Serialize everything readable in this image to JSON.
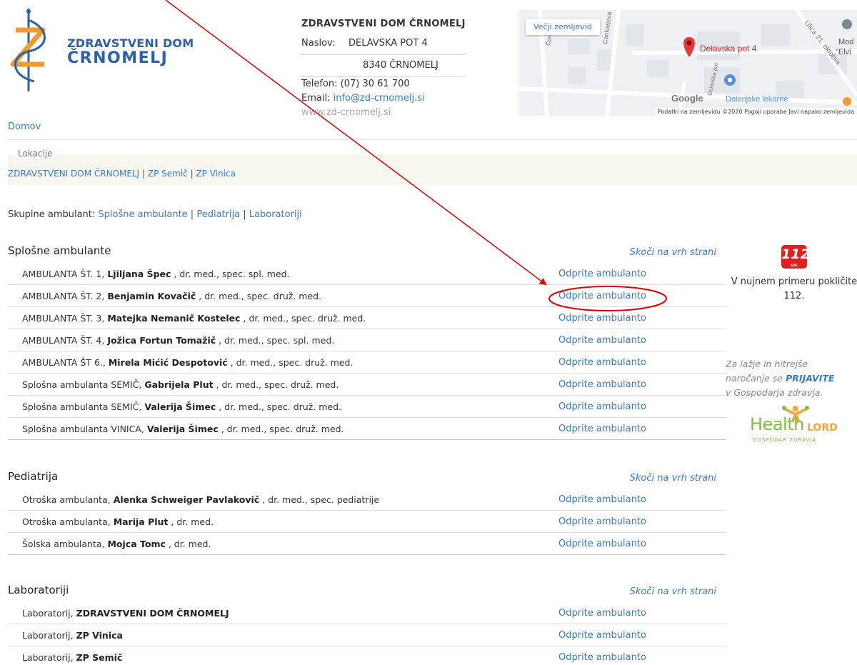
{
  "header": {
    "logo": {
      "line1": "ZDRAVSTVENI DOM",
      "line2": "ČRNOMELJ"
    },
    "title": "ZDRAVSTVENI DOM ČRNOMELJ",
    "address_label": "Naslov:",
    "address_line1": "DELAVSKA POT 4",
    "address_line2": "8340 ČRNOMELJ",
    "phone_label": "Telefon:",
    "phone": "(07) 30 61 700",
    "email_label": "Email:",
    "email": "info@zd-crnomelj.si",
    "web": "www.zd-crnomelj.si"
  },
  "map": {
    "button": "Večji zemljevid",
    "labels": {
      "street1": "Delavska pot 4",
      "street2": "Cankarjeva",
      "street3": "Ulica 21. oktobra",
      "street4": "Čardova",
      "street5": "Delavska pot",
      "pharmacy": "Dolenjske lekarne",
      "poi": "Mod",
      "poi2": "\"Elvi",
      "google": "Google"
    },
    "footer": "Podatki na zemljevidu ©2020   Pogoji uporabe   Javi napako zemljevida"
  },
  "breadcrumb": "Domov",
  "locations": {
    "legend": "Lokacije",
    "links": [
      "ZDRAVSTVENI DOM ČRNOMELJ",
      "ZP Semič",
      "ZP Vinica"
    ],
    "separator": " | "
  },
  "groups": {
    "label": "Skupine ambulant:",
    "links": [
      "Splošne ambulante",
      "Pediatrija",
      "Laboratoriji"
    ]
  },
  "back_to_top": "Skoči na vrh strani",
  "action": "Odprite ambulanto",
  "sections": [
    {
      "title": "Splošne ambulante",
      "rows": [
        {
          "prefix": "AMBULANTA ŠT. 1, ",
          "name": "Ljiljana Špec",
          "suffix": " , dr. med., spec. spl. med."
        },
        {
          "prefix": "AMBULANTA ŠT. 2, ",
          "name": "Benjamin Kovačič",
          "suffix": " , dr. med., spec. druž. med."
        },
        {
          "prefix": "AMBULANTA ŠT. 3, ",
          "name": "Matejka Nemanič Kostelec",
          "suffix": " , dr. med., spec. druž. med."
        },
        {
          "prefix": "AMBULANTA ŠT. 4, ",
          "name": "Jožica Fortun Tomažič",
          "suffix": " , dr. med., spec. spl. med."
        },
        {
          "prefix": "AMBULANTA ŠT 6., ",
          "name": "Mirela Mićić Despotović",
          "suffix": " , dr. med., spec. druž. med."
        },
        {
          "prefix": "Splošna ambulanta SEMIČ, ",
          "name": "Gabrijela Plut",
          "suffix": " , dr. med., spec. druž. med."
        },
        {
          "prefix": "Splošna ambulanta SEMIČ, ",
          "name": "Valerija Šimec",
          "suffix": " , dr. med., spec. druž. med."
        },
        {
          "prefix": "Splošna ambulanta VINICA, ",
          "name": "Valerija Šimec",
          "suffix": " , dr. med., spec. druž. med."
        }
      ]
    },
    {
      "title": "Pediatrija",
      "rows": [
        {
          "prefix": "Otroška ambulanta, ",
          "name": "Alenka Schweiger Pavlakovič",
          "suffix": " , dr. med., spec. pediatrije"
        },
        {
          "prefix": "Otroška ambulanta, ",
          "name": "Marija Plut",
          "suffix": " , dr. med."
        },
        {
          "prefix": "Šolska ambulanta, ",
          "name": "Mojca Tomc",
          "suffix": " , dr. med."
        }
      ]
    },
    {
      "title": "Laboratoriji",
      "rows": [
        {
          "prefix": "Laboratorij, ",
          "name": "ZDRAVSTVENI DOM ČRNOMELJ",
          "suffix": ""
        },
        {
          "prefix": "Laboratorij, ",
          "name": "ZP Vinica",
          "suffix": ""
        },
        {
          "prefix": "Laboratorij, ",
          "name": "ZP Semič",
          "suffix": ""
        }
      ]
    }
  ],
  "sidebar": {
    "emergency_icon": "112",
    "emergency_icon_small": "SOS",
    "emergency_text": "V nujnem primeru pokličite 112.",
    "promo_line1": "Za lažje in hitrejše",
    "promo_line2_pre": "naročanje se ",
    "promo_link": "PRIJAVITE",
    "promo_line3": "v Gospodarja zdravja.",
    "health_logo": {
      "text": "Health",
      "lord": "LORD",
      "sub": "GOSPODAR ZDRAVJA"
    }
  },
  "colors": {
    "link": "#3b7bbf",
    "annotation": "#e00000",
    "emergency": "#e02020"
  }
}
